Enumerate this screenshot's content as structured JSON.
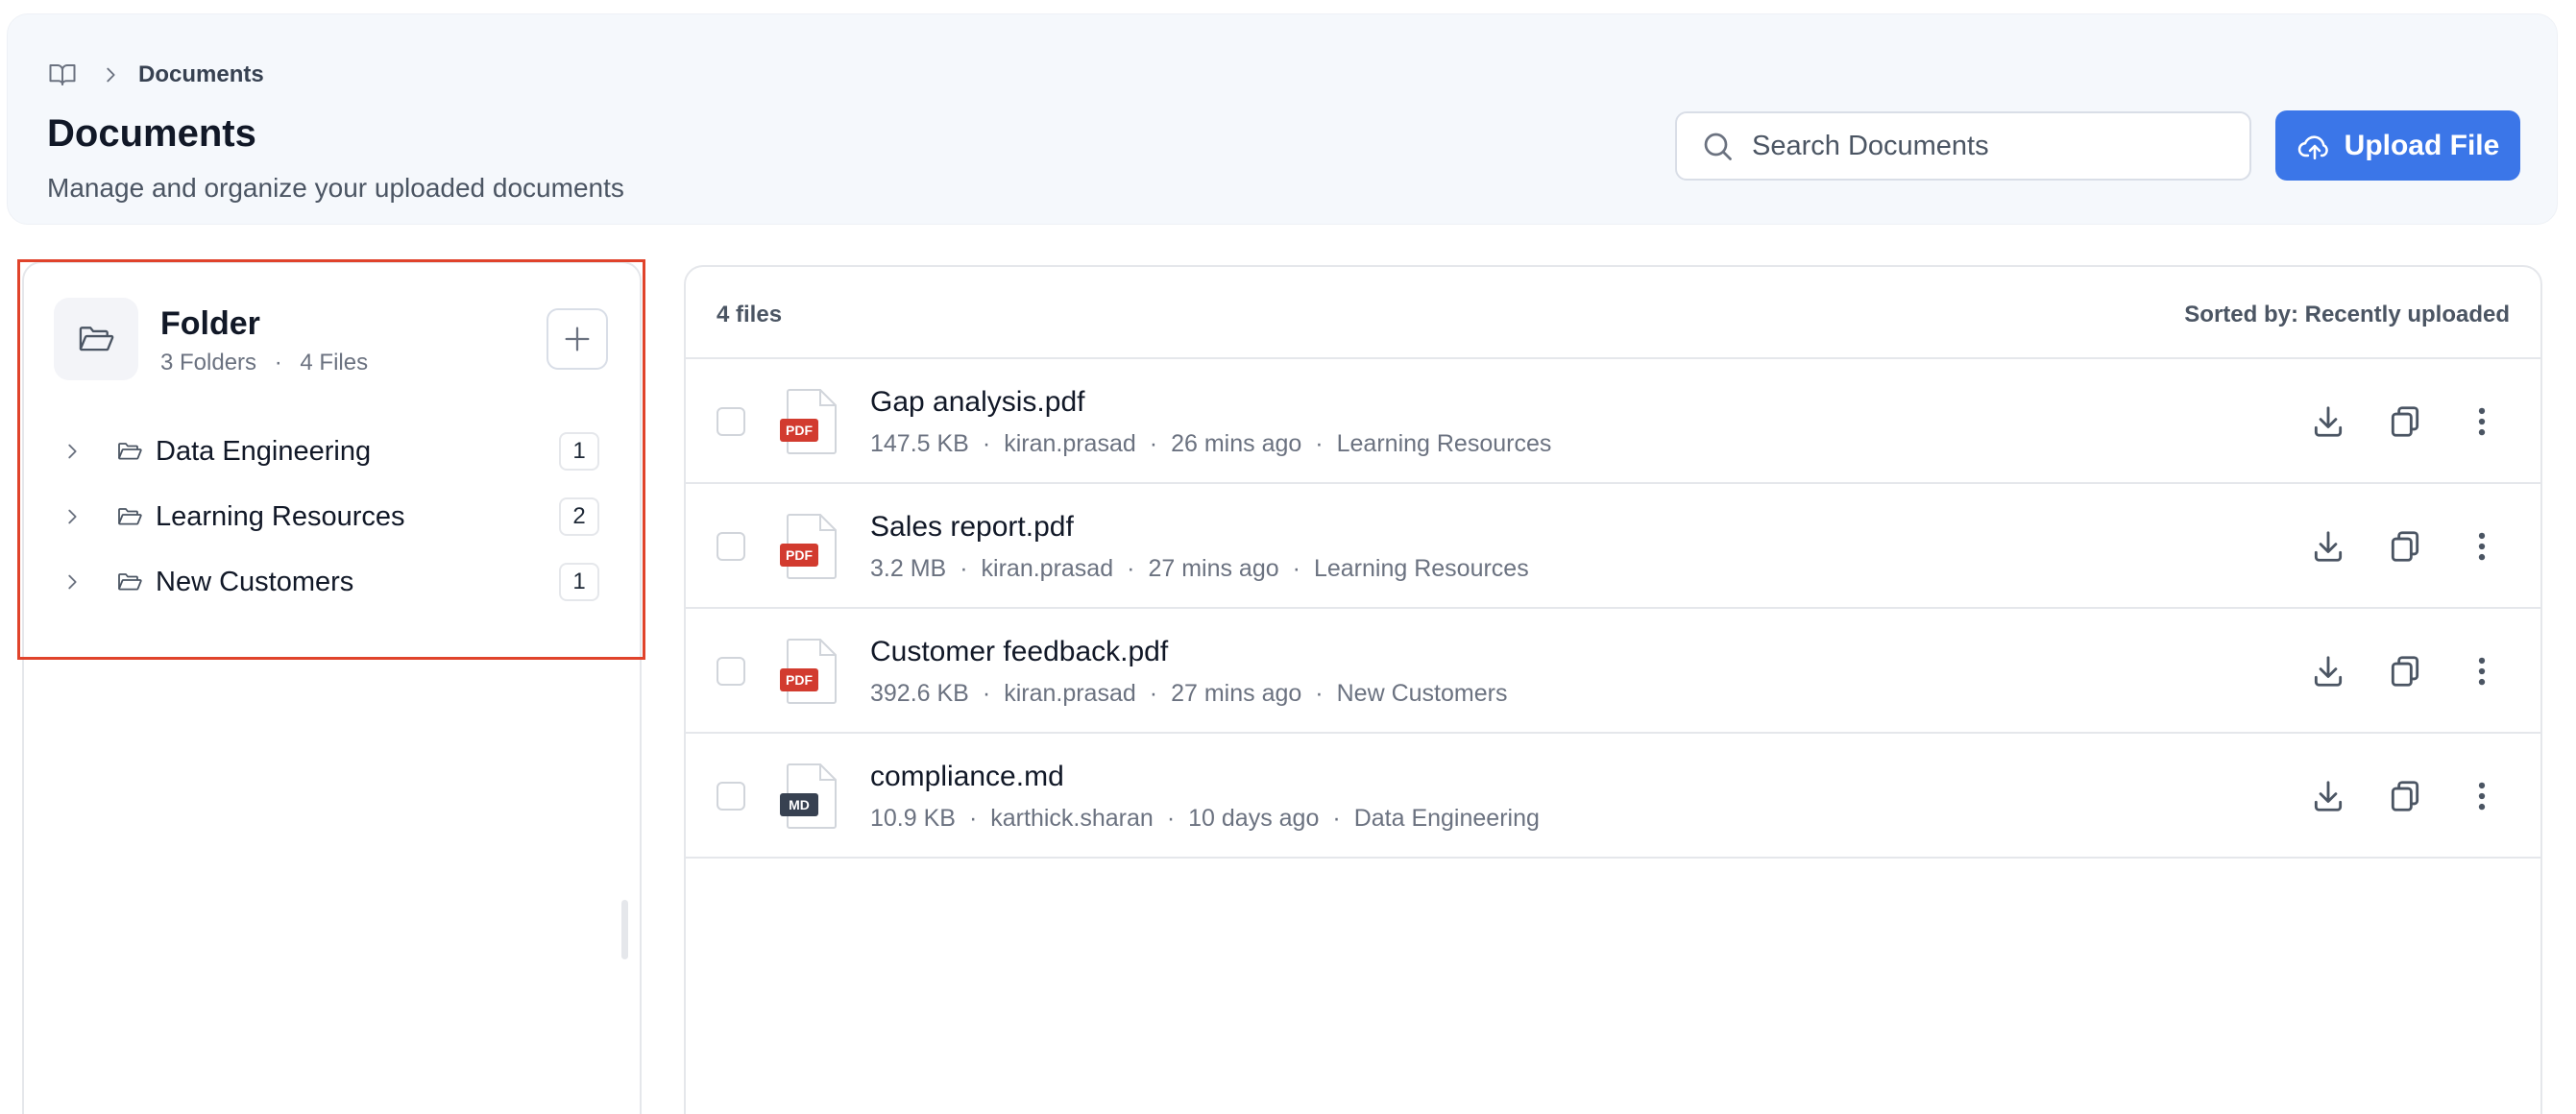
{
  "breadcrumb": {
    "current": "Documents"
  },
  "header": {
    "title": "Documents",
    "subtitle": "Manage and organize your uploaded documents",
    "search_placeholder": "Search Documents",
    "upload_label": "Upload File"
  },
  "sidebar": {
    "title": "Folder",
    "folders_count": "3 Folders",
    "files_count": "4 Files",
    "meta_separator": "·",
    "folders": [
      {
        "name": "Data Engineering",
        "count": "1"
      },
      {
        "name": "Learning Resources",
        "count": "2"
      },
      {
        "name": "New Customers",
        "count": "1"
      }
    ]
  },
  "files": {
    "count_label": "4 files",
    "sort_label": "Sorted by: Recently uploaded",
    "items": [
      {
        "name": "Gap analysis.pdf",
        "type": "PDF",
        "size": "147.5 KB",
        "owner": "kiran.prasad",
        "time": "26 mins ago",
        "folder": "Learning Resources"
      },
      {
        "name": "Sales report.pdf",
        "type": "PDF",
        "size": "3.2 MB",
        "owner": "kiran.prasad",
        "time": "27 mins ago",
        "folder": "Learning Resources"
      },
      {
        "name": "Customer feedback.pdf",
        "type": "PDF",
        "size": "392.6 KB",
        "owner": "kiran.prasad",
        "time": "27 mins ago",
        "folder": "New Customers"
      },
      {
        "name": "compliance.md",
        "type": "MD",
        "size": "10.9 KB",
        "owner": "karthick.sharan",
        "time": "10 days ago",
        "folder": "Data Engineering"
      }
    ]
  },
  "colors": {
    "accent": "#3b76e8",
    "pdf_badge": "#d23b2f",
    "md_badge": "#374151",
    "highlight": "#e0432b"
  }
}
